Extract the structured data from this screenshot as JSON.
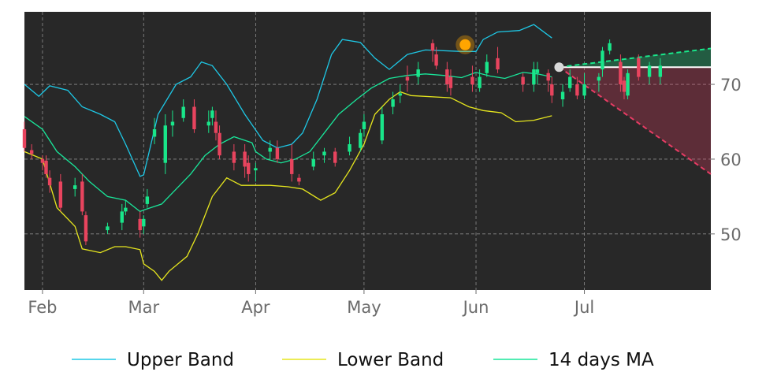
{
  "chart_data": {
    "type": "candlestick",
    "x_ticks": [
      "Feb",
      "Mar",
      "Apr",
      "May",
      "Jun",
      "Jul"
    ],
    "y_ticks": [
      50,
      60,
      70
    ],
    "ylim": [
      42.5,
      79.7
    ],
    "xlim": [
      "2023-01-27",
      "2023-08-05"
    ],
    "grid": true,
    "legend_position": "bottom",
    "colors": {
      "background": "#282828",
      "up_candle": "#19e68a",
      "down_candle": "#e8445e",
      "upper_band": "#1ec8e6",
      "lower_band": "#e6e61e",
      "ma": "#19e69a",
      "highlight": "#ffa500",
      "projection_up": "#19e68a",
      "projection_down": "#e83c64",
      "last_point": "#d9d9d9"
    },
    "legend": [
      {
        "key": "upper",
        "label": "Upper Band",
        "color": "#1ec8e6"
      },
      {
        "key": "lower",
        "label": "Lower Band",
        "color": "#e6e61e"
      },
      {
        "key": "ma",
        "label": "14 days MA",
        "color": "#19e69a"
      }
    ],
    "upper_band": [
      [
        "2023-01-27",
        70.0
      ],
      [
        "2023-01-31",
        68.4
      ],
      [
        "2023-02-03",
        69.8
      ],
      [
        "2023-02-08",
        69.2
      ],
      [
        "2023-02-12",
        67.0
      ],
      [
        "2023-02-17",
        66.0
      ],
      [
        "2023-02-21",
        65.0
      ],
      [
        "2023-02-24",
        62.0
      ],
      [
        "2023-02-28",
        57.7
      ],
      [
        "2023-03-01",
        57.9
      ],
      [
        "2023-03-05",
        66.0
      ],
      [
        "2023-03-10",
        70.0
      ],
      [
        "2023-03-14",
        71.0
      ],
      [
        "2023-03-17",
        73.0
      ],
      [
        "2023-03-20",
        72.5
      ],
      [
        "2023-03-24",
        70.0
      ],
      [
        "2023-03-29",
        66.0
      ],
      [
        "2023-04-03",
        62.5
      ],
      [
        "2023-04-07",
        61.5
      ],
      [
        "2023-04-11",
        62.0
      ],
      [
        "2023-04-14",
        63.5
      ],
      [
        "2023-04-18",
        68.0
      ],
      [
        "2023-04-22",
        74.0
      ],
      [
        "2023-04-25",
        76.0
      ],
      [
        "2023-04-30",
        75.6
      ],
      [
        "2023-05-04",
        73.5
      ],
      [
        "2023-05-08",
        72.0
      ],
      [
        "2023-05-13",
        74.0
      ],
      [
        "2023-05-18",
        74.6
      ],
      [
        "2023-05-28",
        74.4
      ],
      [
        "2023-06-01",
        74.4
      ],
      [
        "2023-06-03",
        76.0
      ],
      [
        "2023-06-07",
        77.0
      ],
      [
        "2023-06-13",
        77.2
      ],
      [
        "2023-06-17",
        78.0
      ],
      [
        "2023-06-22",
        76.2
      ]
    ],
    "lower_band": [
      [
        "2023-01-27",
        61.0
      ],
      [
        "2023-02-01",
        60.0
      ],
      [
        "2023-02-05",
        53.5
      ],
      [
        "2023-02-10",
        51.0
      ],
      [
        "2023-02-12",
        48.0
      ],
      [
        "2023-02-17",
        47.5
      ],
      [
        "2023-02-21",
        48.3
      ],
      [
        "2023-02-24",
        48.3
      ],
      [
        "2023-02-28",
        47.9
      ],
      [
        "2023-03-01",
        46.0
      ],
      [
        "2023-03-04",
        45.0
      ],
      [
        "2023-03-06",
        43.8
      ],
      [
        "2023-03-08",
        45.0
      ],
      [
        "2023-03-13",
        47.0
      ],
      [
        "2023-03-16",
        50.0
      ],
      [
        "2023-03-20",
        55.0
      ],
      [
        "2023-03-24",
        57.5
      ],
      [
        "2023-03-28",
        56.5
      ],
      [
        "2023-04-01",
        56.5
      ],
      [
        "2023-04-05",
        56.5
      ],
      [
        "2023-04-10",
        56.3
      ],
      [
        "2023-04-14",
        56.0
      ],
      [
        "2023-04-19",
        54.5
      ],
      [
        "2023-04-23",
        55.5
      ],
      [
        "2023-04-27",
        58.5
      ],
      [
        "2023-05-01",
        62.0
      ],
      [
        "2023-05-04",
        66.0
      ],
      [
        "2023-05-08",
        68.0
      ],
      [
        "2023-05-11",
        69.0
      ],
      [
        "2023-05-14",
        68.5
      ],
      [
        "2023-05-25",
        68.2
      ],
      [
        "2023-05-30",
        67.0
      ],
      [
        "2023-06-03",
        66.5
      ],
      [
        "2023-06-08",
        66.2
      ],
      [
        "2023-06-12",
        65.0
      ],
      [
        "2023-06-17",
        65.2
      ],
      [
        "2023-06-22",
        65.8
      ]
    ],
    "ma": [
      [
        "2023-01-27",
        65.7
      ],
      [
        "2023-02-01",
        64.0
      ],
      [
        "2023-02-05",
        61.0
      ],
      [
        "2023-02-10",
        59.0
      ],
      [
        "2023-02-14",
        57.0
      ],
      [
        "2023-02-19",
        55.0
      ],
      [
        "2023-02-24",
        54.5
      ],
      [
        "2023-02-28",
        53.0
      ],
      [
        "2023-03-01",
        53.2
      ],
      [
        "2023-03-06",
        54.0
      ],
      [
        "2023-03-10",
        56.0
      ],
      [
        "2023-03-14",
        58.0
      ],
      [
        "2023-03-18",
        60.5
      ],
      [
        "2023-03-22",
        62.0
      ],
      [
        "2023-03-26",
        63.0
      ],
      [
        "2023-03-31",
        62.2
      ],
      [
        "2023-04-01",
        61.0
      ],
      [
        "2023-04-04",
        60.0
      ],
      [
        "2023-04-08",
        59.5
      ],
      [
        "2023-04-12",
        60.0
      ],
      [
        "2023-04-16",
        61.0
      ],
      [
        "2023-04-20",
        63.5
      ],
      [
        "2023-04-24",
        66.0
      ],
      [
        "2023-04-29",
        68.0
      ],
      [
        "2023-05-03",
        69.5
      ],
      [
        "2023-05-08",
        70.8
      ],
      [
        "2023-05-13",
        71.2
      ],
      [
        "2023-05-18",
        71.4
      ],
      [
        "2023-05-23",
        71.2
      ],
      [
        "2023-05-28",
        70.9
      ],
      [
        "2023-06-01",
        71.6
      ],
      [
        "2023-06-05",
        71.1
      ],
      [
        "2023-06-09",
        70.8
      ],
      [
        "2023-06-14",
        71.6
      ],
      [
        "2023-06-18",
        71.4
      ],
      [
        "2023-06-22",
        71.0
      ]
    ],
    "candles": [
      [
        "2023-01-27",
        64.0,
        61.5,
        65.0,
        61.0
      ],
      [
        "2023-01-29",
        61.2,
        60.7,
        62.0,
        60.0
      ],
      [
        "2023-02-01",
        60.0,
        59.5,
        60.5,
        58.5
      ],
      [
        "2023-02-02",
        59.8,
        58.0,
        60.5,
        57.5
      ],
      [
        "2023-02-03",
        57.5,
        56.5,
        58.5,
        55.5
      ],
      [
        "2023-02-06",
        57.0,
        53.5,
        58.0,
        53.0
      ],
      [
        "2023-02-10",
        56.0,
        56.5,
        57.5,
        55.0
      ],
      [
        "2023-02-12",
        57.0,
        53.0,
        58.0,
        52.5
      ],
      [
        "2023-02-13",
        52.5,
        49.0,
        53.0,
        48.5
      ],
      [
        "2023-02-19",
        50.5,
        51.0,
        51.5,
        50.0
      ],
      [
        "2023-02-23",
        51.5,
        53.0,
        54.0,
        50.5
      ],
      [
        "2023-02-24",
        53.0,
        53.5,
        54.5,
        52.5
      ],
      [
        "2023-02-28",
        52.0,
        50.5,
        53.0,
        49.5
      ],
      [
        "2023-03-01",
        51.0,
        52.0,
        52.5,
        50.0
      ],
      [
        "2023-03-02",
        54.0,
        55.0,
        56.0,
        53.5
      ],
      [
        "2023-03-04",
        63.0,
        64.0,
        65.5,
        62.0
      ],
      [
        "2023-03-07",
        59.5,
        64.5,
        66.0,
        58.0
      ],
      [
        "2023-03-09",
        64.5,
        65.0,
        66.5,
        63.0
      ],
      [
        "2023-03-12",
        65.5,
        67.0,
        68.0,
        65.0
      ],
      [
        "2023-03-15",
        67.0,
        64.0,
        68.0,
        63.5
      ],
      [
        "2023-03-19",
        64.5,
        65.0,
        66.5,
        63.5
      ],
      [
        "2023-03-20",
        65.5,
        66.5,
        67.0,
        64.5
      ],
      [
        "2023-03-21",
        65.0,
        63.5,
        66.5,
        62.5
      ],
      [
        "2023-03-22",
        63.5,
        60.5,
        64.5,
        60.0
      ],
      [
        "2023-03-26",
        61.0,
        59.5,
        62.0,
        58.5
      ],
      [
        "2023-03-29",
        61.0,
        59.0,
        62.0,
        57.5
      ],
      [
        "2023-03-30",
        59.5,
        58.0,
        60.5,
        57.0
      ],
      [
        "2023-04-01",
        58.5,
        58.8,
        59.5,
        57.0
      ],
      [
        "2023-04-05",
        61.0,
        61.5,
        62.5,
        60.0
      ],
      [
        "2023-04-07",
        61.5,
        60.0,
        62.5,
        59.5
      ],
      [
        "2023-04-11",
        60.0,
        58.0,
        62.0,
        57.0
      ],
      [
        "2023-04-13",
        57.5,
        57.0,
        58.0,
        56.5
      ],
      [
        "2023-04-17",
        59.0,
        60.0,
        61.0,
        58.5
      ],
      [
        "2023-04-20",
        60.5,
        61.0,
        61.5,
        59.5
      ],
      [
        "2023-04-23",
        61.0,
        59.5,
        61.5,
        59.0
      ],
      [
        "2023-04-27",
        61.0,
        62.0,
        63.0,
        60.5
      ],
      [
        "2023-04-30",
        61.5,
        63.5,
        64.0,
        61.0
      ],
      [
        "2023-05-01",
        64.0,
        65.0,
        66.0,
        63.0
      ],
      [
        "2023-05-06",
        62.5,
        66.0,
        67.0,
        62.0
      ],
      [
        "2023-05-09",
        67.0,
        68.0,
        69.0,
        66.0
      ],
      [
        "2023-05-11",
        68.5,
        68.8,
        70.0,
        67.5
      ],
      [
        "2023-05-13",
        71.0,
        70.5,
        72.5,
        69.0
      ],
      [
        "2023-05-16",
        71.0,
        72.0,
        73.0,
        70.0
      ],
      [
        "2023-05-20",
        75.5,
        74.5,
        76.0,
        73.0
      ],
      [
        "2023-05-21",
        74.0,
        72.5,
        75.0,
        72.0
      ],
      [
        "2023-05-24",
        72.0,
        70.0,
        73.0,
        69.0
      ],
      [
        "2023-05-25",
        71.0,
        69.5,
        72.0,
        68.5
      ],
      [
        "2023-05-31",
        71.0,
        70.0,
        72.5,
        69.0
      ],
      [
        "2023-06-02",
        69.5,
        71.0,
        72.0,
        69.0
      ],
      [
        "2023-06-04",
        71.5,
        73.0,
        74.0,
        71.0
      ],
      [
        "2023-06-07",
        73.5,
        72.0,
        75.0,
        71.5
      ],
      [
        "2023-06-14",
        71.0,
        70.0,
        71.5,
        69.0
      ],
      [
        "2023-06-17",
        70.0,
        72.0,
        73.0,
        69.0
      ],
      [
        "2023-06-18",
        71.5,
        72.0,
        73.0,
        70.0
      ],
      [
        "2023-06-21",
        71.5,
        70.5,
        72.0,
        69.0
      ],
      [
        "2023-06-22",
        70.0,
        68.5,
        71.0,
        67.5
      ],
      [
        "2023-06-25",
        68.0,
        69.0,
        70.0,
        67.0
      ],
      [
        "2023-06-27",
        69.5,
        71.0,
        72.0,
        69.0
      ],
      [
        "2023-06-29",
        70.0,
        68.5,
        71.0,
        68.0
      ],
      [
        "2023-07-01",
        68.5,
        70.0,
        71.5,
        68.0
      ],
      [
        "2023-07-05",
        70.5,
        71.0,
        71.5,
        69.0
      ],
      [
        "2023-07-06",
        72.0,
        74.5,
        75.0,
        71.0
      ],
      [
        "2023-07-08",
        74.5,
        75.5,
        76.0,
        74.0
      ],
      [
        "2023-07-11",
        73.0,
        70.0,
        74.0,
        69.0
      ],
      [
        "2023-07-12",
        70.5,
        69.0,
        71.0,
        68.0
      ],
      [
        "2023-07-13",
        68.5,
        71.5,
        72.0,
        68.0
      ],
      [
        "2023-07-16",
        73.5,
        71.0,
        74.0,
        70.5
      ],
      [
        "2023-07-19",
        71.0,
        72.5,
        73.0,
        70.0
      ],
      [
        "2023-07-22",
        71.0,
        72.5,
        73.5,
        70.0
      ]
    ],
    "highlight_point": [
      "2023-05-29",
      75.3
    ],
    "last_point": [
      "2023-06-24",
      72.3
    ],
    "projection": {
      "start": [
        "2023-06-24",
        72.3
      ],
      "end_date": "2023-08-05",
      "upper_end": 74.8,
      "lower_end": 58.0
    }
  }
}
